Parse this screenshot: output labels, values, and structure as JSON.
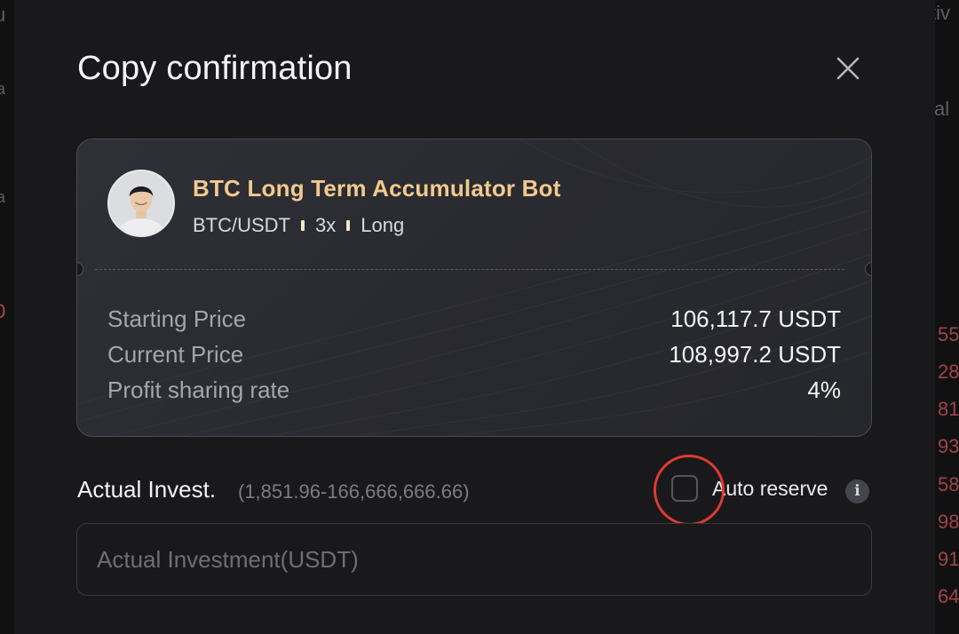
{
  "background": {
    "left_fragments": [
      "u",
      "a",
      "a",
      "0"
    ],
    "right_fragments": [
      "tiv",
      "al",
      "55",
      "28",
      "81",
      "93",
      "58",
      "98",
      "91",
      "64"
    ]
  },
  "modal": {
    "title": "Copy confirmation",
    "close_icon": "close-icon"
  },
  "bot": {
    "name": "BTC Long Term Accumulator Bot",
    "pair": "BTC/USDT",
    "leverage": "3x",
    "direction": "Long",
    "stats": [
      {
        "label": "Starting Price",
        "value": "106,117.7 USDT"
      },
      {
        "label": "Current Price",
        "value": "108,997.2 USDT"
      },
      {
        "label": "Profit sharing rate",
        "value": "4%"
      }
    ]
  },
  "invest": {
    "label": "Actual Invest.",
    "range": "(1,851.96-166,666,666.66)",
    "placeholder": "Actual Investment(USDT)",
    "auto_reserve_label": "Auto reserve",
    "auto_reserve_checked": false,
    "info_icon": "info-icon"
  },
  "colors": {
    "accent_gold": "#f2c98e",
    "highlight_red": "#e03a32",
    "modal_bg": "#19191b"
  }
}
